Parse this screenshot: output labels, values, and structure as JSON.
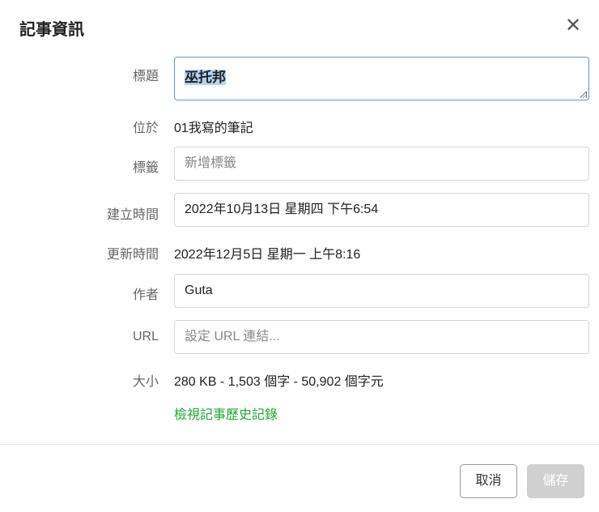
{
  "dialog": {
    "title": "記事資訊",
    "close_icon": "close-icon"
  },
  "fields": {
    "title": {
      "label": "標題",
      "value": "巫托邦"
    },
    "location": {
      "label": "位於",
      "value": "01我寫的筆記"
    },
    "tags": {
      "label": "標籤",
      "placeholder": "新增標籤"
    },
    "created": {
      "label": "建立時間",
      "value": "2022年10月13日 星期四 下午6:54"
    },
    "updated": {
      "label": "更新時間",
      "value": "2022年12月5日 星期一 上午8:16"
    },
    "author": {
      "label": "作者",
      "value": "Guta"
    },
    "url": {
      "label": "URL",
      "placeholder": "設定 URL 連結..."
    },
    "size": {
      "label": "大小",
      "value": "280 KB - 1,503 個字 - 50,902 個字元"
    }
  },
  "history_link": "檢視記事歷史記錄",
  "buttons": {
    "cancel": "取消",
    "save": "儲存"
  },
  "colors": {
    "link": "#1da832",
    "focus": "#5b9bc8"
  }
}
